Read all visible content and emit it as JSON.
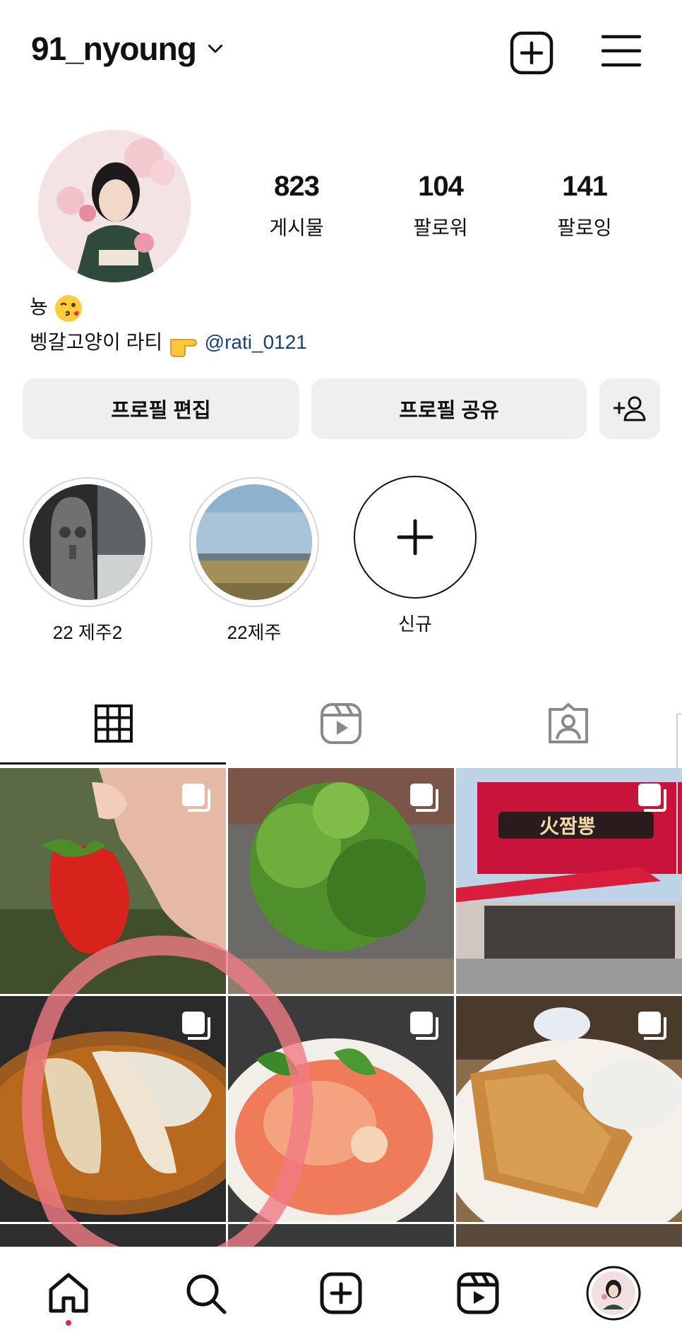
{
  "header": {
    "username": "91_nyoung",
    "icons": {
      "add": "add-square-icon",
      "menu": "hamburger-menu-icon",
      "dropdown": "chevron-down-icon"
    }
  },
  "profile": {
    "stats": [
      {
        "value": "823",
        "label": "게시물"
      },
      {
        "value": "104",
        "label": "팔로워"
      },
      {
        "value": "141",
        "label": "팔로잉"
      }
    ],
    "bio_line1": "뇽",
    "bio_line2": "벵갈고양이 라티",
    "bio_mention": "@rati_0121"
  },
  "buttons": {
    "edit": "프로필 편집",
    "share": "프로필 공유",
    "discover": "person-add-icon"
  },
  "highlights": [
    {
      "label": "22 제주2"
    },
    {
      "label": "22제주"
    },
    {
      "label": "신규"
    }
  ],
  "tabs": [
    {
      "icon": "grid-icon",
      "active": true
    },
    {
      "icon": "reels-icon",
      "active": false
    },
    {
      "icon": "tagged-icon",
      "active": false
    }
  ],
  "posts": [
    {
      "subject": "strawberry",
      "multi": true
    },
    {
      "subject": "plant",
      "multi": true
    },
    {
      "subject": "restaurant",
      "multi": true
    },
    {
      "subject": "noodles",
      "multi": true
    },
    {
      "subject": "sashimi",
      "multi": true
    },
    {
      "subject": "tonkatsu",
      "multi": true
    }
  ],
  "storefront_sign": "火짬뽕",
  "nav": [
    {
      "icon": "home-icon"
    },
    {
      "icon": "search-icon"
    },
    {
      "icon": "create-icon"
    },
    {
      "icon": "reels-icon"
    },
    {
      "icon": "profile-avatar-icon"
    }
  ],
  "colors": {
    "mention": "#1b3f7a",
    "button_bg": "#efefef",
    "notification_dot": "#e0245e"
  }
}
